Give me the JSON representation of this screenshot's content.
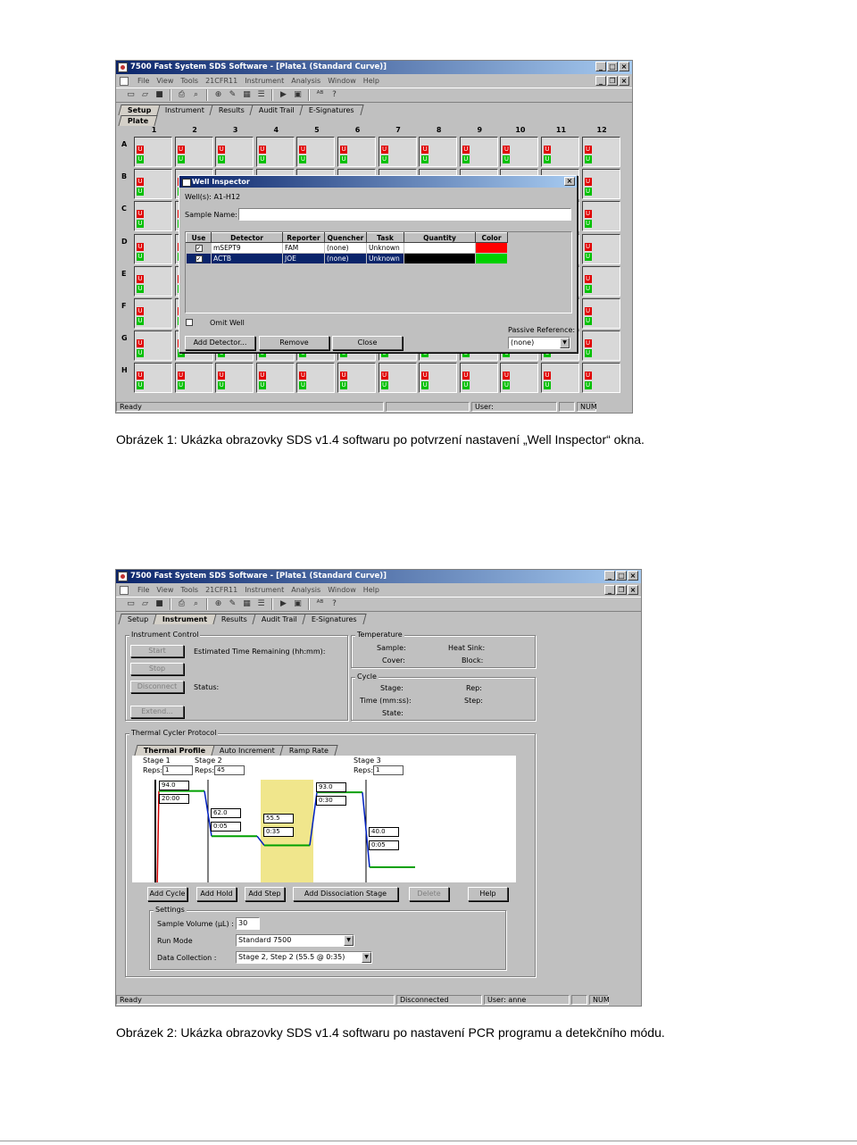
{
  "figure1": {
    "window_title": "7500 Fast System SDS Software - [Plate1 (Standard Curve)]",
    "menu": [
      "File",
      "View",
      "Tools",
      "21CFR11",
      "Instrument",
      "Analysis",
      "Window",
      "Help"
    ],
    "tabs": [
      "Setup",
      "Instrument",
      "Results",
      "Audit Trail",
      "E-Signatures"
    ],
    "subtab": "Plate",
    "columns": [
      "1",
      "2",
      "3",
      "4",
      "5",
      "6",
      "7",
      "8",
      "9",
      "10",
      "11",
      "12"
    ],
    "rows": [
      "A",
      "B",
      "C",
      "D",
      "E",
      "F",
      "G",
      "H"
    ],
    "well_marker": "U",
    "dialog": {
      "title": "Well Inspector",
      "wells_label": "Well(s): A1-H12",
      "sample_name_label": "Sample Name:",
      "sample_name_value": "",
      "table_headers": [
        "Use",
        "Detector",
        "Reporter",
        "Quencher",
        "Task",
        "Quantity",
        "Color"
      ],
      "rows": [
        {
          "use": "✓",
          "detector": "mSEPT9",
          "reporter": "FAM",
          "quencher": "(none)",
          "task": "Unknown",
          "quantity": "",
          "color": "#ff0000"
        },
        {
          "use": "✓",
          "detector": "ACTB",
          "reporter": "JOE",
          "quencher": "(none)",
          "task": "Unknown",
          "quantity": "",
          "color": "#00d000"
        }
      ],
      "omit_well": "Omit Well",
      "passive_reference_label": "Passive Reference:",
      "passive_reference_value": "(none)",
      "buttons": {
        "add_detector": "Add Detector...",
        "remove": "Remove",
        "close": "Close"
      }
    },
    "status": {
      "left": "Ready",
      "user": "User:",
      "num": "NUM"
    }
  },
  "caption1": "Obrázek 1: Ukázka obrazovky SDS v1.4 softwaru po potvrzení nastavení „Well Inspector“ okna.",
  "figure2": {
    "window_title": "7500 Fast System SDS Software - [Plate1 (Standard Curve)]",
    "menu": [
      "File",
      "View",
      "Tools",
      "21CFR11",
      "Instrument",
      "Analysis",
      "Window",
      "Help"
    ],
    "tabs": [
      "Setup",
      "Instrument",
      "Results",
      "Audit Trail",
      "E-Signatures"
    ],
    "instrument_control": {
      "title": "Instrument Control",
      "buttons": [
        "Start",
        "Stop",
        "Disconnect",
        "Extend..."
      ],
      "estimated_time": "Estimated Time Remaining (hh:mm):",
      "status": "Status:"
    },
    "temperature": {
      "title": "Temperature",
      "sample": "Sample:",
      "heat_sink": "Heat Sink:",
      "cover": "Cover:",
      "block": "Block:"
    },
    "cycle": {
      "title": "Cycle",
      "stage": "Stage:",
      "rep": "Rep:",
      "time": "Time (mm:ss):",
      "step": "Step:",
      "state": "State:"
    },
    "protocol": {
      "title": "Thermal Cycler Protocol",
      "tabs": [
        "Thermal Profile",
        "Auto Increment",
        "Ramp Rate"
      ],
      "reps_label": "Reps:",
      "stages": [
        {
          "name": "Stage 1",
          "reps": "1",
          "steps": [
            {
              "temp": "94.0",
              "time": "20:00"
            }
          ]
        },
        {
          "name": "Stage 2",
          "reps": "45",
          "steps": [
            {
              "temp": "62.0",
              "time": "0:05"
            },
            {
              "temp": "55.5",
              "time": "0:35"
            },
            {
              "temp": "93.0",
              "time": "0:30"
            }
          ]
        },
        {
          "name": "Stage 3",
          "reps": "1",
          "steps": [
            {
              "temp": "40.0",
              "time": "0:05"
            }
          ]
        }
      ],
      "buttons": [
        "Add Cycle",
        "Add Hold",
        "Add Step",
        "Add Dissociation Stage",
        "Delete",
        "Help"
      ],
      "settings": {
        "title": "Settings",
        "sample_volume_label": "Sample Volume (µL) :",
        "sample_volume_value": "30",
        "run_mode_label": "Run Mode",
        "run_mode_value": "Standard 7500",
        "data_collection_label": "Data Collection :",
        "data_collection_value": "Stage 2, Step 2 (55.5 @ 0:35)"
      }
    },
    "status": {
      "left": "Ready",
      "conn": "Disconnected",
      "user": "User: anne",
      "num": "NUM"
    }
  },
  "caption2": "Obrázek 2: Ukázka obrazovky SDS v1.4 softwaru po nastavení PCR programu a detekčního módu."
}
